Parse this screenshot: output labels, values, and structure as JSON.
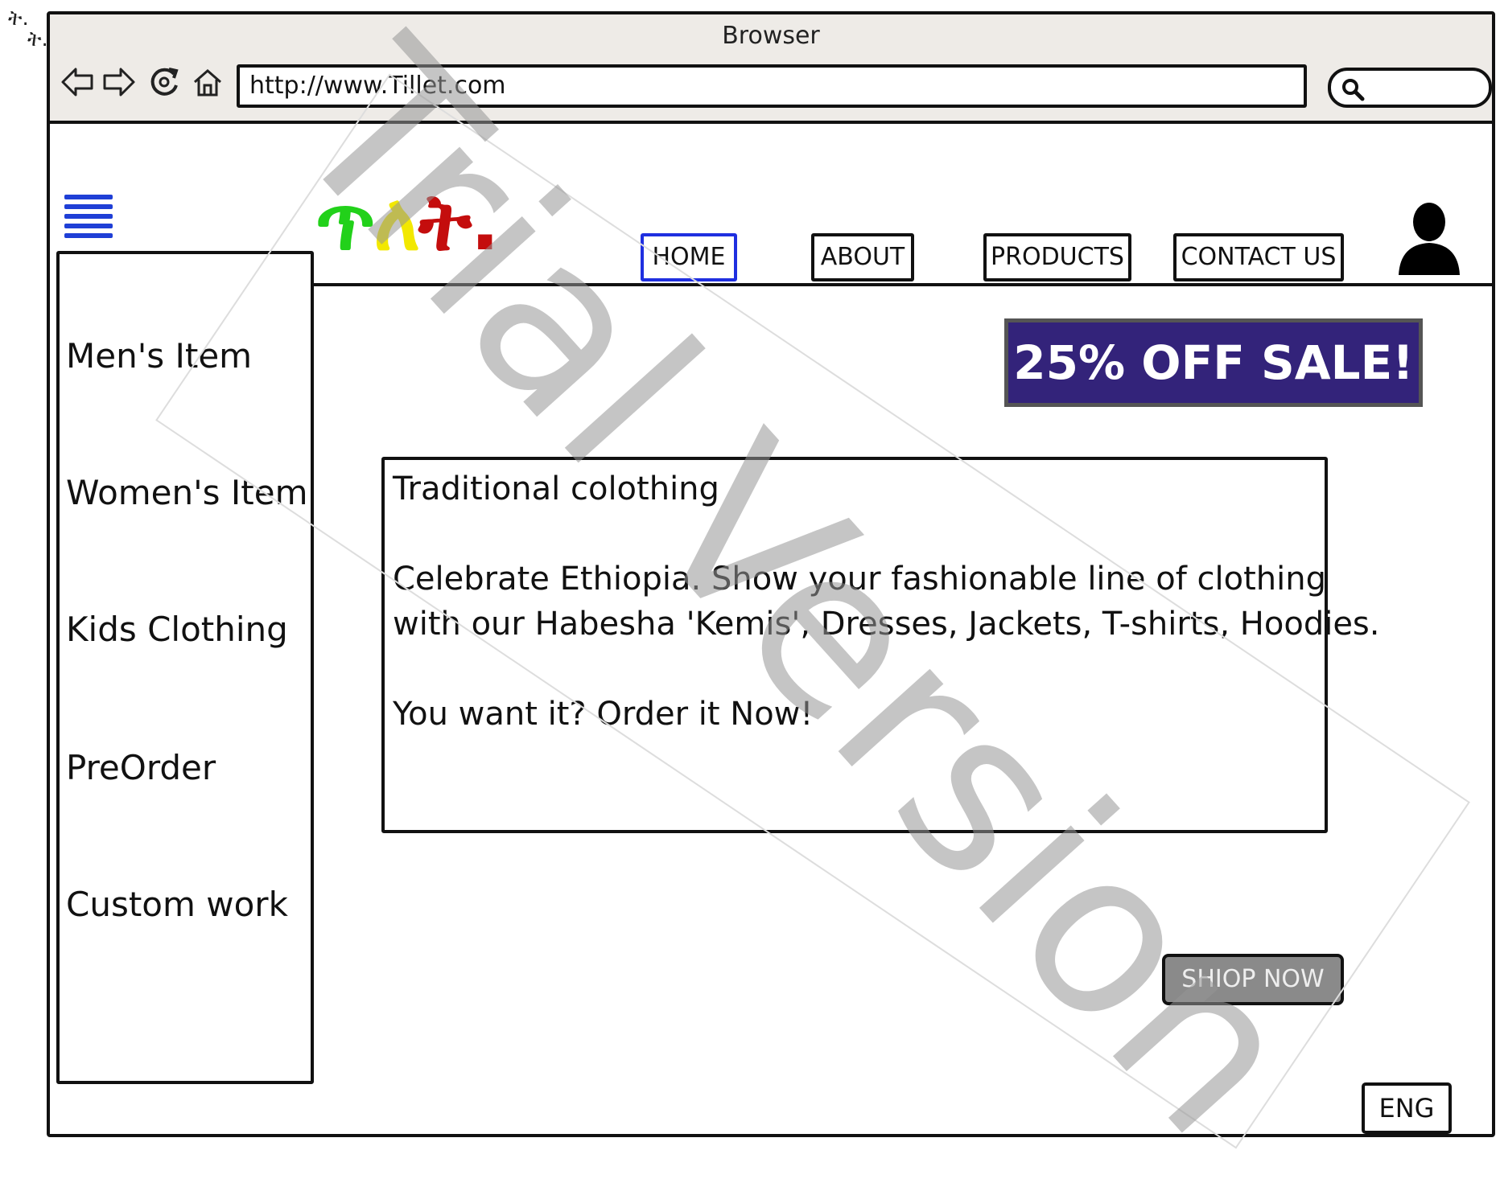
{
  "corner_glyph": "ት.",
  "browser": {
    "title": "Browser",
    "url": "http://www.Tillet.com"
  },
  "logo": {
    "letters": [
      "ጥ",
      "ለ",
      "ት",
      "."
    ],
    "colors": [
      "#22d11a",
      "#f2e800",
      "#c40d0d",
      "#c40d0d"
    ]
  },
  "nav": {
    "home": "HOME",
    "about": "ABOUT",
    "products": "PRODUCTS",
    "contact": "CONTACT US",
    "active_color": "#1f2fe0"
  },
  "sidebar": {
    "items": [
      {
        "label": "Men's Item"
      },
      {
        "label": "Women's Item"
      },
      {
        "label": "Kids Clothing"
      },
      {
        "label": "PreOrder"
      },
      {
        "label": "Custom work"
      }
    ]
  },
  "banner": {
    "text": "25% OFF SALE!",
    "background": "#33237a"
  },
  "content": {
    "heading": "Traditional colothing",
    "line1": "Celebrate Ethiopia. Show your fashionable line of clothing",
    "line2": "with our Habesha 'Kemis', Dresses, Jackets, T-shirts, Hoodies.",
    "cta_text": "You want it? Order it Now!"
  },
  "shop_button": "SHIOP NOW",
  "language": "ENG",
  "watermark": "Trial Version",
  "icons": [
    "back-arrow-icon",
    "forward-arrow-icon",
    "reload-icon",
    "home-icon",
    "search-icon",
    "hamburger-menu-icon",
    "user-avatar-icon"
  ]
}
